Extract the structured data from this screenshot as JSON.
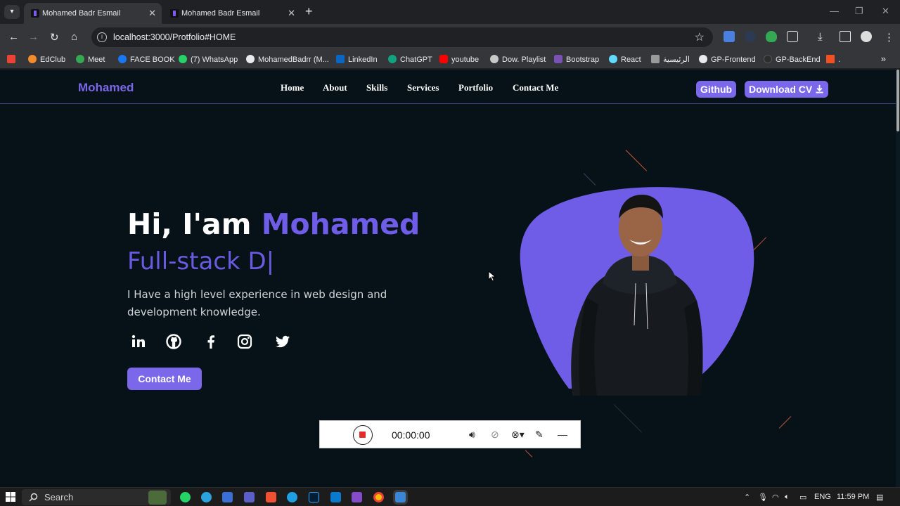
{
  "browser": {
    "tabs": [
      {
        "title": "Mohamed Badr Esmail",
        "active": true
      },
      {
        "title": "Mohamed Badr Esmail",
        "active": false
      }
    ],
    "new_tab": "+",
    "url": "localhost:3000/Protfolio#HOME",
    "bookmarks": [
      {
        "label": "EdClub",
        "color": "#f28b2a"
      },
      {
        "label": "Meet",
        "color": "#34a853"
      },
      {
        "label": "FACE BOOK",
        "color": "#1877f2"
      },
      {
        "label": "(7) WhatsApp",
        "color": "#25d366"
      },
      {
        "label": "MohamedBadrr (M...",
        "color": "#e8eaed"
      },
      {
        "label": "LinkedIn",
        "color": "#0a66c2"
      },
      {
        "label": "ChatGPT",
        "color": "#10a37f"
      },
      {
        "label": "youtube",
        "color": "#ff0000"
      },
      {
        "label": "Dow. Playlist",
        "color": "#c8c8c8"
      },
      {
        "label": "Bootstrap",
        "color": "#7952b3"
      },
      {
        "label": "React",
        "color": "#61dafb"
      },
      {
        "label": "الرئيسية",
        "color": "#9a9a9a"
      },
      {
        "label": "GP-Frontend",
        "color": "#e8eaed"
      },
      {
        "label": "GP-BackEnd",
        "color": "#2d2d2d"
      },
      {
        "label": ".",
        "color": "#f25022"
      }
    ]
  },
  "site": {
    "brand": "Mohamed",
    "nav": [
      "Home",
      "About",
      "Skills",
      "Services",
      "Portfolio",
      "Contact Me"
    ],
    "github_label": "Github",
    "download_cv_label": "Download CV",
    "hero": {
      "greeting": "Hi, I'am",
      "name": "Mohamed",
      "typing": "Full-stack D|",
      "description": "I Have a high level experience in web design and development knowledge.",
      "cta_label": "Contact Me"
    },
    "accent": "#7b67ea",
    "background": "#061217"
  },
  "recorder": {
    "time": "00:00:00"
  },
  "taskbar": {
    "search_label": "Search",
    "language": "ENG",
    "clock": "11:59 PM"
  }
}
